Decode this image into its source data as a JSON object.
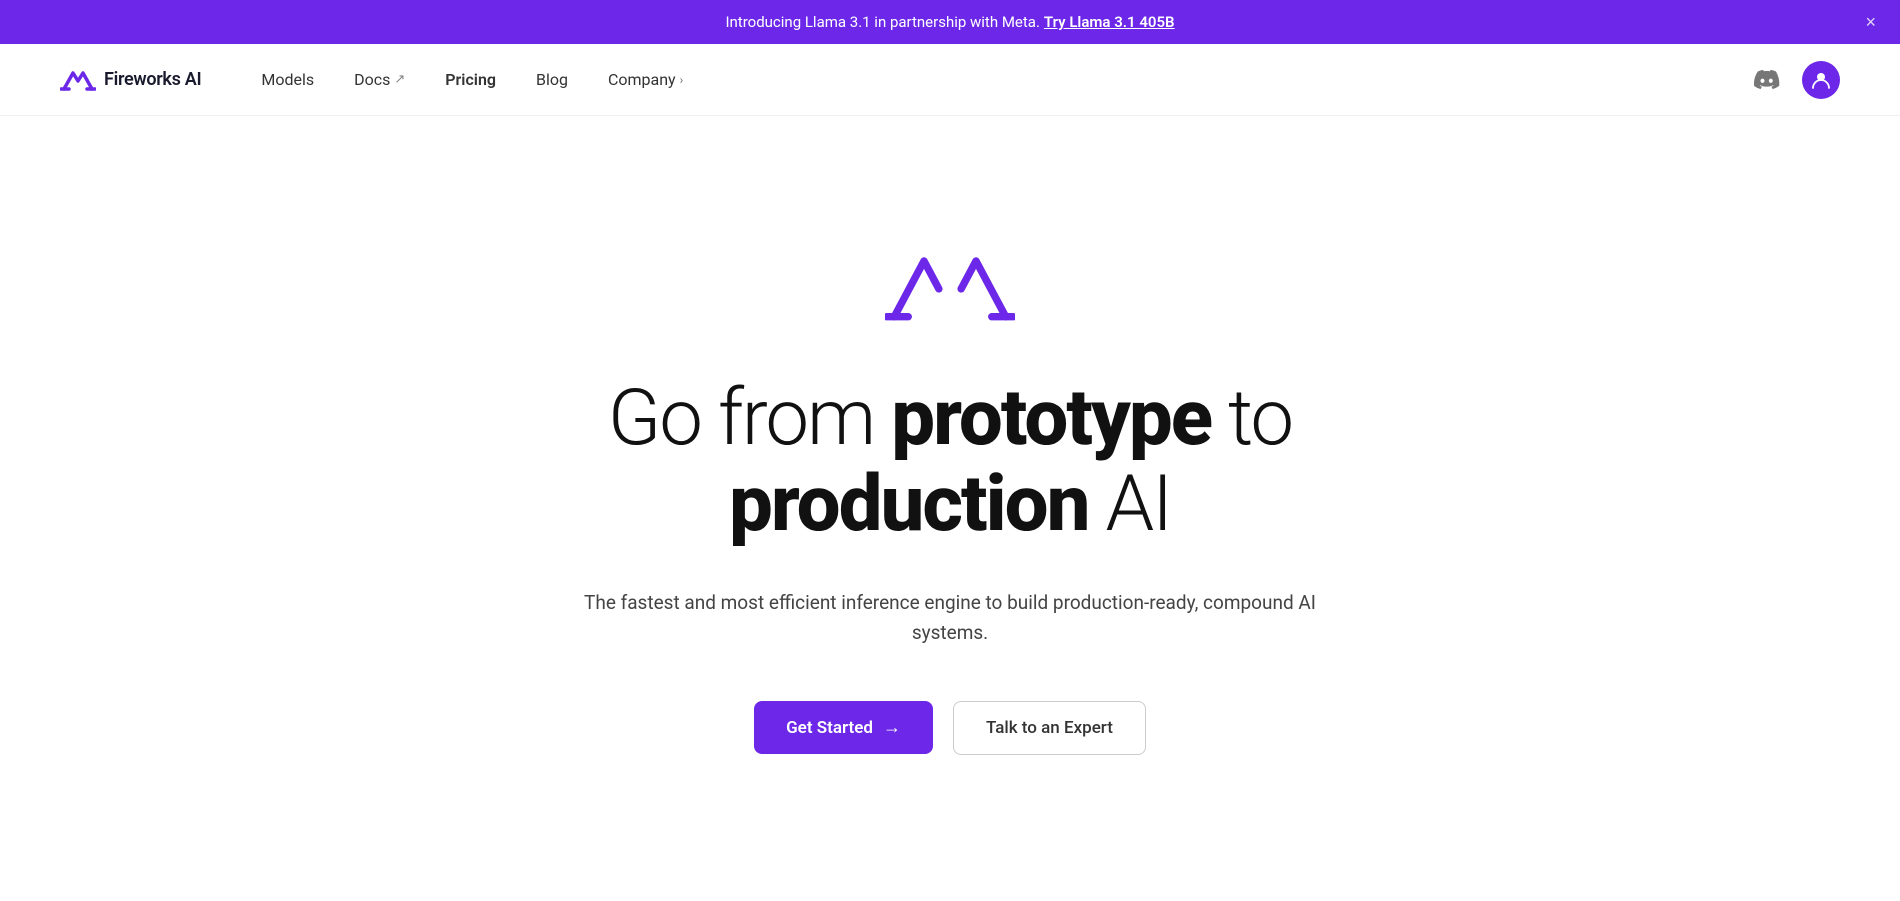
{
  "banner": {
    "text": "Introducing Llama 3.1 in partnership with Meta.",
    "link_text": "Try Llama 3.1 405B",
    "link_href": "#"
  },
  "nav": {
    "logo_text": "Fireworks AI",
    "links": [
      {
        "label": "Models",
        "href": "#",
        "has_external": false
      },
      {
        "label": "Docs",
        "href": "#",
        "has_external": true
      },
      {
        "label": "Pricing",
        "href": "#",
        "has_external": false
      },
      {
        "label": "Blog",
        "href": "#",
        "has_external": false
      },
      {
        "label": "Company",
        "href": "#",
        "has_chevron": true
      }
    ]
  },
  "hero": {
    "title_part1": "Go from ",
    "title_bold1": "prototype",
    "title_part2": " to ",
    "title_bold2": "production",
    "title_part3": " AI",
    "subtitle": "The fastest and most efficient inference engine to build production-ready, compound AI systems.",
    "cta_primary": "Get Started",
    "cta_secondary": "Talk to an Expert",
    "arrow": "→"
  },
  "colors": {
    "brand_purple": "#6c27e8",
    "banner_bg": "#6c27e8"
  }
}
